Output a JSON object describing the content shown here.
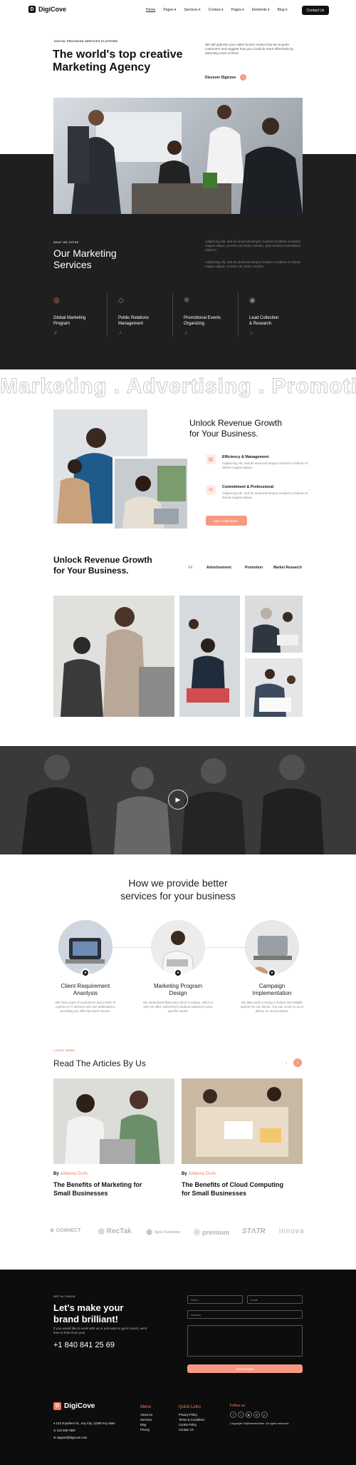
{
  "nav": {
    "logo": "DigiCove",
    "items": [
      "Home",
      "Pages",
      "Services",
      "Contact",
      "Pages",
      "Elements",
      "Blog"
    ],
    "cta": "Contact Us"
  },
  "hero": {
    "kicker": "DIGITAL PROVIDING SERVICES PLATFORM",
    "title_line1": "The world's top creative",
    "title_line2": "Marketing Agency",
    "description": "We will optimize your sales funnel, review how we acquire customers and suggest how you could do more effectively by attracting more of them.",
    "discover": "Discover Digicove"
  },
  "offer": {
    "kicker": "WHAT WE OFFER",
    "title_line1": "Our Marketing",
    "title_line2": "Services",
    "para1": "Adipiscing elit, sed do eiusmod tempor incidunt ut labore et dolore magna aliqua. Ut enim ad minim veniam, quis nostrud exercitation ullamco.",
    "para2": "Adipiscing elit, sed do eiusmod tempor incidunt ut labore et dolore magna aliqua. Ut enim ad minim veniam.",
    "services": [
      {
        "line1": "Global Marketing",
        "line2": "Program"
      },
      {
        "line1": "Public Relations",
        "line2": "Management"
      },
      {
        "line1": "Promotional Events",
        "line2": "Organizing"
      },
      {
        "line1": "Lead Collection",
        "line2": "& Research"
      }
    ]
  },
  "marquee": "Marketing . Advertising . Promotion",
  "growth": {
    "title_line1": "Unlock Revenue Growth",
    "title_line2": "for Your Business.",
    "f1_title": "Efficiency & Management",
    "f1_desc": "Adipiscing elit, sed do eiusmod tempor incidunt ut labore et dolore magna aliqua.",
    "f2_title": "Commitment & Professional",
    "f2_desc": "Adipiscing elit, sed do eiusmod tempor incidunt ut labore et dolore magna aliqua.",
    "cta": "Lets Collaborate"
  },
  "portfolio": {
    "title_line1": "Unlock Revenue Growth",
    "title_line2": "for Your Business.",
    "tabs": [
      "All",
      "Advertisement",
      "Promotion",
      "Market Research"
    ]
  },
  "process": {
    "title_line1": "How we provide better",
    "title_line2": "services for your business",
    "steps": [
      {
        "line1": "Client Requirement",
        "line2": "Ananlysis",
        "desc": "We have years of experience and a team of experts in IT services who are dedicated to providing you with top-notch service."
      },
      {
        "line1": "Marketing Program",
        "line2": "Design",
        "desc": "We understand that every client is unique, which is why we offer customized solutions tailored to your specific needs."
      },
      {
        "line1": "Campaign",
        "line2": "Implementation",
        "desc": "We take pride in being a trusted and reliable partner for our clients. You can count on us to deliver on our promises."
      }
    ]
  },
  "articles": {
    "kicker": "LATEST NEWS",
    "title": "Read The Articles By Us",
    "by": "By",
    "author": "Johanna Doris",
    "items": [
      {
        "line1": "The Benefits of Marketing for",
        "line2": "Small Businesses"
      },
      {
        "line1": "The Benefits of Cloud Computing",
        "line2": "for Small Businesses"
      }
    ]
  },
  "brands": [
    "CONNECT",
    "RecTak",
    "Sync Solutions",
    "premium",
    "STΛTR",
    "innova"
  ],
  "contact": {
    "kicker": "GET IN TOUCH",
    "title_line1": "Let's make your",
    "title_line2": "brand brilliant!",
    "desc": "If you would like to work with us or just want to get in touch, we'd love to hear from you!",
    "phone": "+1 840 841 25 69",
    "name_ph": "Name",
    "email_ph": "Email",
    "website_ph": "Website",
    "submit": "Submit Now"
  },
  "footer": {
    "logo": "DigiCove",
    "address": "123 Anywhere St., Any City, 12345 Any State",
    "phone": "123-456-7890",
    "email": "support@digicove.com",
    "menu_title": "Menu",
    "menu": [
      "About Us",
      "Services",
      "Blog",
      "Pricing"
    ],
    "quick_title": "Quick Links",
    "quick": [
      "Privacy Policy",
      "Terms & Conditions",
      "Cookie Policy",
      "Contact Us"
    ],
    "follow_title": "Follow us",
    "copyright": "Copyright ©njtthemebuilder. All rights reserved."
  },
  "colors": {
    "accent": "#f07d5f",
    "dark": "#1f1f1f",
    "footer": "#0d0d0d"
  }
}
